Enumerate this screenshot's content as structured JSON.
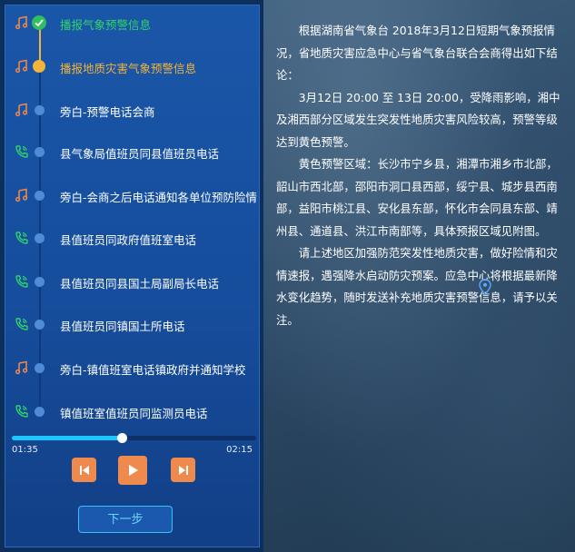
{
  "steps": [
    {
      "label": "播报气象预警信息",
      "icon": "music-note-icon",
      "state": "done"
    },
    {
      "label": "播报地质灾害气象预警信息",
      "icon": "music-note-icon",
      "state": "current"
    },
    {
      "label": "旁白-预警电话会商",
      "icon": "music-note-icon",
      "state": "pending"
    },
    {
      "label": "县气象局值班员同县值班员电话",
      "icon": "phone-icon",
      "state": "pending"
    },
    {
      "label": "旁白-会商之后电话通知各单位预防险情",
      "icon": "music-note-icon",
      "state": "pending"
    },
    {
      "label": "县值班员同政府值班室电话",
      "icon": "phone-icon",
      "state": "pending"
    },
    {
      "label": "县值班员同县国土局副局长电话",
      "icon": "phone-icon",
      "state": "pending"
    },
    {
      "label": "县值班员同镇国土所电话",
      "icon": "phone-icon",
      "state": "pending"
    },
    {
      "label": "旁白-镇值班室电话镇政府并通知学校",
      "icon": "music-note-icon",
      "state": "pending"
    },
    {
      "label": "镇值班室值班员同监测员电话",
      "icon": "phone-icon",
      "state": "pending"
    }
  ],
  "player": {
    "current_time": "01:35",
    "total_time": "02:15",
    "progress": 0.45
  },
  "next_button": "下一步",
  "notice": {
    "paragraphs": [
      "根据湖南省气象台 2018年3月12日短期气象预报情况，省地质灾害应急中心与省气象台联合会商得出如下结论：",
      "3月12日 20:00 至 13日 20:00，受降雨影响，湘中及湘西部分区域发生突发性地质灾害风险较高，预警等级达到黄色预警。",
      "黄色预警区域：长沙市宁乡县，湘潭市湘乡市北部，韶山市西北部，邵阳市洞口县西部，绥宁县、城步县西南部，益阳市桃江县、安化县东部，怀化市会同县东部、靖州县、通道县、洪江市南部等，具体预报区域见附图。",
      "请上述地区加强防范突发性地质灾害，做好险情和灾情速报，遇强降水启动防灾预案。应急中心将根据最新降水变化趋势，随时发送补充地质灾害预警信息，请予以关注。"
    ]
  },
  "colors": {
    "done": "#2fd36a",
    "current": "#f2b43a",
    "accent": "#ef8a4f",
    "progress": "#1ec8ff"
  }
}
